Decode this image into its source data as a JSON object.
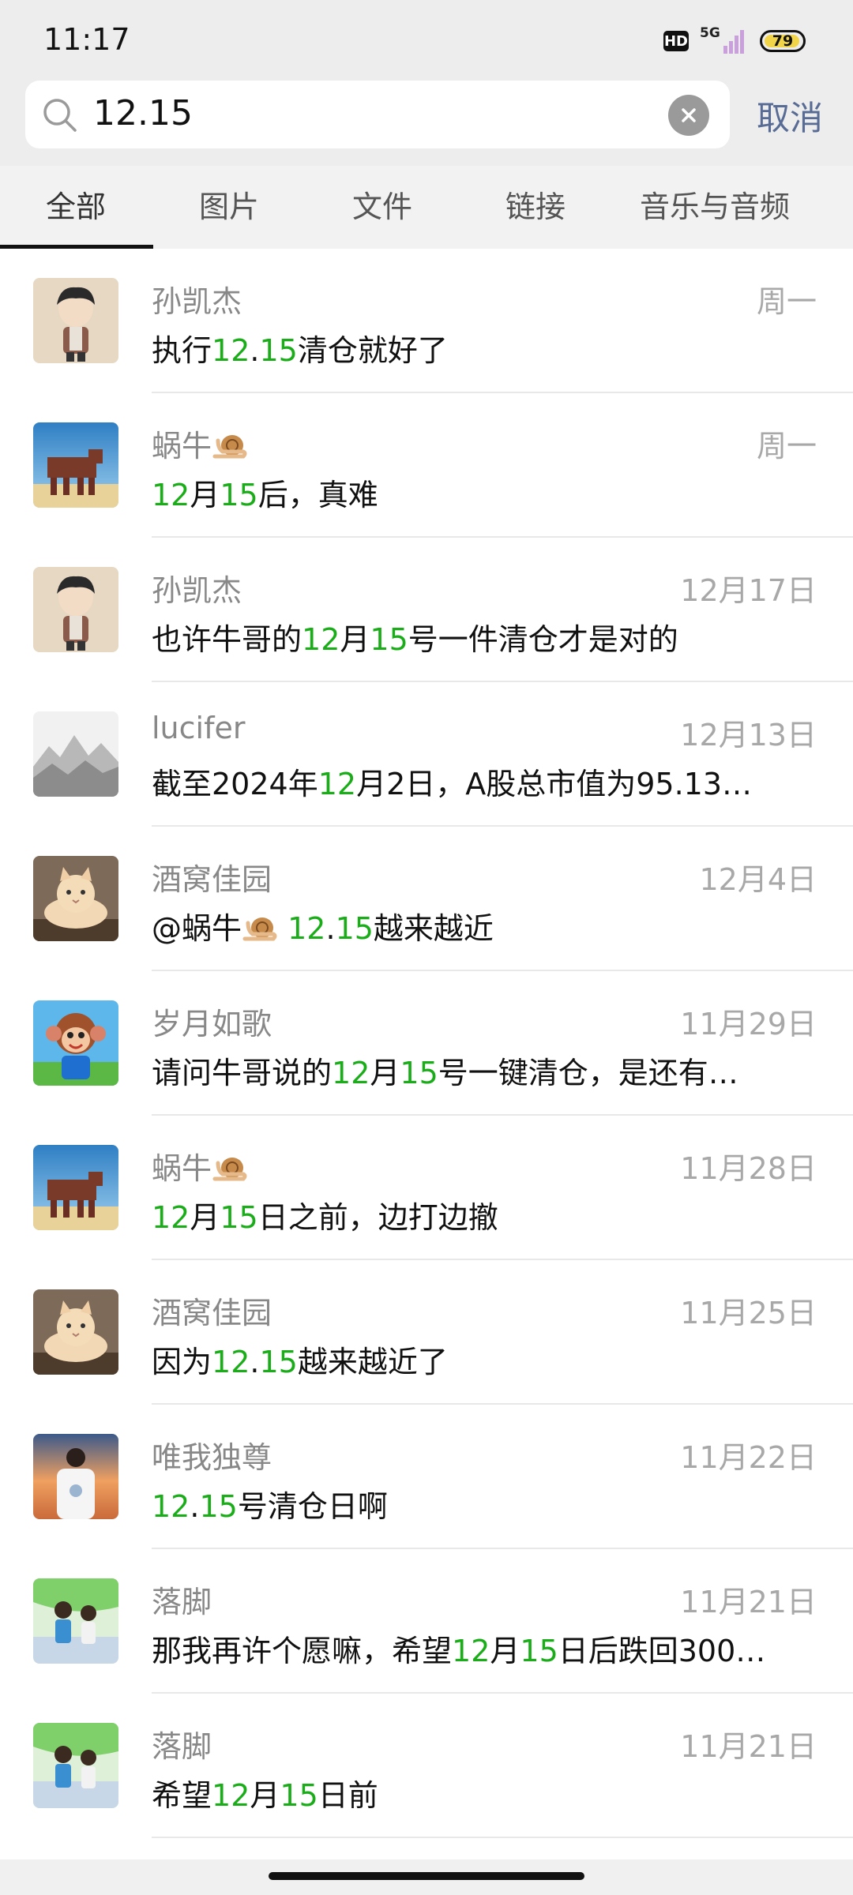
{
  "status_bar": {
    "time": "11:17",
    "hd_label": "HD",
    "network_label": "5G",
    "battery_percent": "79"
  },
  "search": {
    "query": "12.15",
    "cancel_label": "取消"
  },
  "tabs": [
    "全部",
    "图片",
    "文件",
    "链接",
    "音乐与音频"
  ],
  "active_tab": "全部",
  "results": [
    {
      "name": "孙凯杰",
      "date": "周一",
      "snippet": "执行12.15清仓就好了"
    },
    {
      "name": "蜗牛",
      "date": "周一",
      "snippet": "12月15后，真难"
    },
    {
      "name": "孙凯杰",
      "date": "12月17日",
      "snippet": "也许牛哥的12月15号一件清仓才是对的"
    },
    {
      "name": "lucifer",
      "date": "12月13日",
      "snippet": "截至2024年12月2日，A股总市值为95.13…"
    },
    {
      "name": "酒窝佳园",
      "date": "12月4日",
      "snippet": "@蜗牛 12.15越来越近"
    },
    {
      "name": "岁月如歌",
      "date": "11月29日",
      "snippet": "请问牛哥说的12月15号一键清仓，是还有…"
    },
    {
      "name": "蜗牛",
      "date": "11月28日",
      "snippet": "12月15日之前，边打边撤"
    },
    {
      "name": "酒窝佳园",
      "date": "11月25日",
      "snippet": "因为12.15越来越近了"
    },
    {
      "name": "唯我独尊",
      "date": "11月22日",
      "snippet": "12.15号清仓日啊"
    },
    {
      "name": "落脚",
      "date": "11月21日",
      "snippet": "那我再许个愿嘛，希望12月15日后跌回300…"
    },
    {
      "name": "落脚",
      "date": "11月21日",
      "snippet": "希望12月15日前"
    }
  ],
  "colors": {
    "highlight": "#1aad19",
    "cancel_link": "#576b95",
    "header_bg": "#ededed"
  },
  "icons": [
    "search-icon",
    "clear-icon",
    "snail-emoji-icon"
  ]
}
